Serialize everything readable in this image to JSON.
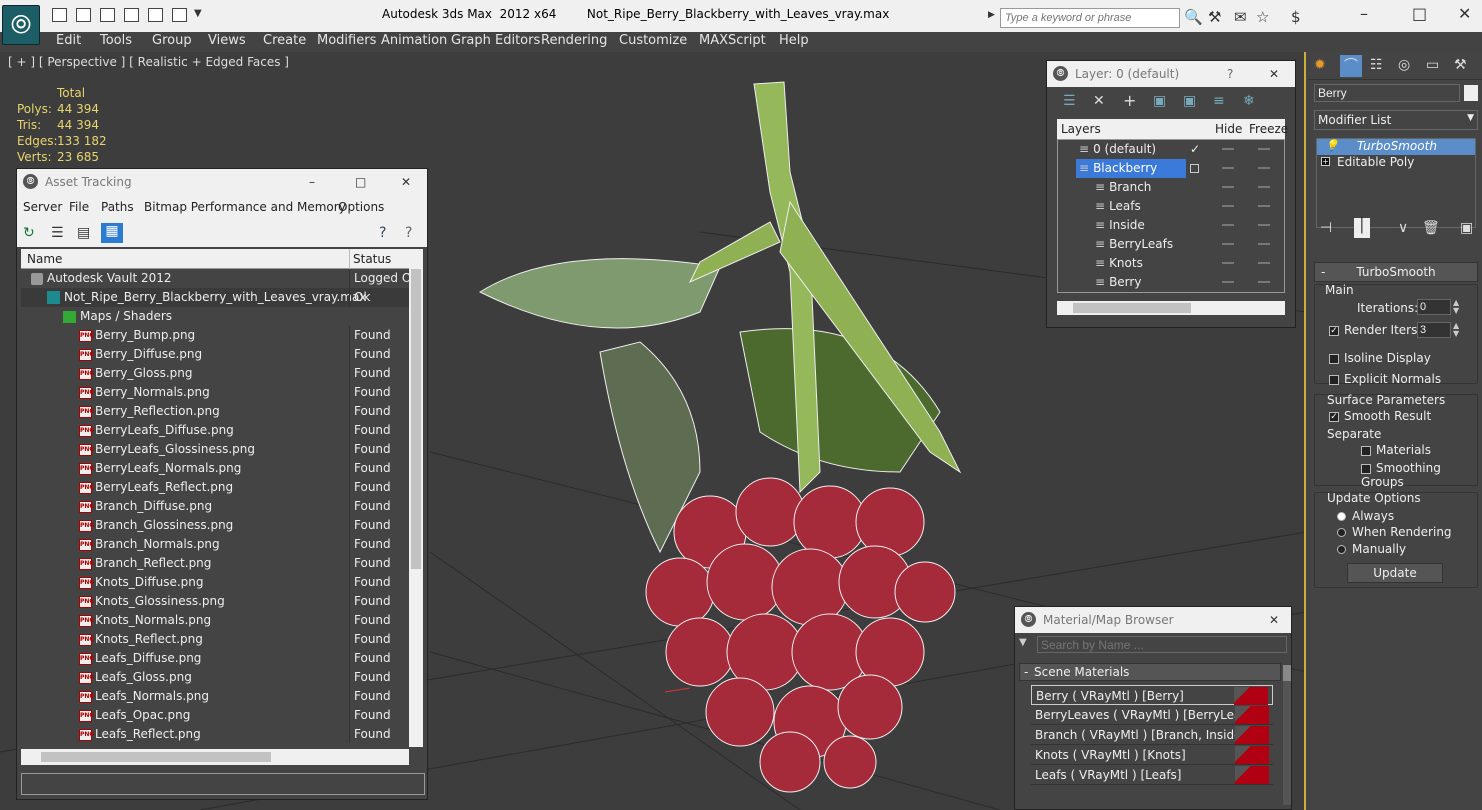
{
  "titlebar": {
    "title": "Autodesk 3ds Max  2012 x64        Not_Ripe_Berry_Blackberry_with_Leaves_vray.max",
    "search_placeholder": "Type a keyword or phrase"
  },
  "menu": [
    "Edit",
    "Tools",
    "Group",
    "Views",
    "Create",
    "Modifiers",
    "Animation",
    "Graph Editors",
    "Rendering",
    "Customize",
    "MAXScript",
    "Help"
  ],
  "viewport": {
    "label": "[ + ] [ Perspective ] [ Realistic + Edged Faces ]",
    "stats_header": "Total",
    "stats": [
      {
        "label": "Polys:",
        "value": "44 394"
      },
      {
        "label": "Tris:",
        "value": "44 394"
      },
      {
        "label": "Edges:",
        "value": "133 182"
      },
      {
        "label": "Verts:",
        "value": "23 685"
      }
    ]
  },
  "asset_tracking": {
    "title": "Asset Tracking",
    "menu": [
      "Server",
      "File",
      "Paths",
      "Bitmap Performance and Memory",
      "Options"
    ],
    "col_name": "Name",
    "col_status": "Status",
    "rows": [
      {
        "name": "Autodesk Vault 2012",
        "status": "Logged Ou",
        "indent": 1,
        "icon": "vault"
      },
      {
        "name": "Not_Ripe_Berry_Blackberry_with_Leaves_vray.max",
        "status": "Ok",
        "indent": 2,
        "icon": "max"
      },
      {
        "name": "Maps / Shaders",
        "status": "",
        "indent": 3,
        "icon": "maps"
      },
      {
        "name": "Berry_Bump.png",
        "status": "Found",
        "indent": 4,
        "icon": "png"
      },
      {
        "name": "Berry_Diffuse.png",
        "status": "Found",
        "indent": 4,
        "icon": "png"
      },
      {
        "name": "Berry_Gloss.png",
        "status": "Found",
        "indent": 4,
        "icon": "png"
      },
      {
        "name": "Berry_Normals.png",
        "status": "Found",
        "indent": 4,
        "icon": "png"
      },
      {
        "name": "Berry_Reflection.png",
        "status": "Found",
        "indent": 4,
        "icon": "png"
      },
      {
        "name": "BerryLeafs_Diffuse.png",
        "status": "Found",
        "indent": 4,
        "icon": "png"
      },
      {
        "name": "BerryLeafs_Glossiness.png",
        "status": "Found",
        "indent": 4,
        "icon": "png"
      },
      {
        "name": "BerryLeafs_Normals.png",
        "status": "Found",
        "indent": 4,
        "icon": "png"
      },
      {
        "name": "BerryLeafs_Reflect.png",
        "status": "Found",
        "indent": 4,
        "icon": "png"
      },
      {
        "name": "Branch_Diffuse.png",
        "status": "Found",
        "indent": 4,
        "icon": "png"
      },
      {
        "name": "Branch_Glossiness.png",
        "status": "Found",
        "indent": 4,
        "icon": "png"
      },
      {
        "name": "Branch_Normals.png",
        "status": "Found",
        "indent": 4,
        "icon": "png"
      },
      {
        "name": "Branch_Reflect.png",
        "status": "Found",
        "indent": 4,
        "icon": "png"
      },
      {
        "name": "Knots_Diffuse.png",
        "status": "Found",
        "indent": 4,
        "icon": "png"
      },
      {
        "name": "Knots_Glossiness.png",
        "status": "Found",
        "indent": 4,
        "icon": "png"
      },
      {
        "name": "Knots_Normals.png",
        "status": "Found",
        "indent": 4,
        "icon": "png"
      },
      {
        "name": "Knots_Reflect.png",
        "status": "Found",
        "indent": 4,
        "icon": "png"
      },
      {
        "name": "Leafs_Diffuse.png",
        "status": "Found",
        "indent": 4,
        "icon": "png"
      },
      {
        "name": "Leafs_Gloss.png",
        "status": "Found",
        "indent": 4,
        "icon": "png"
      },
      {
        "name": "Leafs_Normals.png",
        "status": "Found",
        "indent": 4,
        "icon": "png"
      },
      {
        "name": "Leafs_Opac.png",
        "status": "Found",
        "indent": 4,
        "icon": "png"
      },
      {
        "name": "Leafs_Reflect.png",
        "status": "Found",
        "indent": 4,
        "icon": "png"
      }
    ]
  },
  "layer_panel": {
    "title": "Layer: 0 (default)",
    "help": "?",
    "col_layers": "Layers",
    "col_hide": "Hide",
    "col_freeze": "Freeze",
    "rows": [
      {
        "name": "0 (default)",
        "level": 1,
        "selected": false,
        "active": true
      },
      {
        "name": "Blackberry",
        "level": 1,
        "selected": true,
        "active": false
      },
      {
        "name": "Branch",
        "level": 2,
        "selected": false,
        "active": false
      },
      {
        "name": "Leafs",
        "level": 2,
        "selected": false,
        "active": false
      },
      {
        "name": "Inside",
        "level": 2,
        "selected": false,
        "active": false
      },
      {
        "name": "BerryLeafs",
        "level": 2,
        "selected": false,
        "active": false
      },
      {
        "name": "Knots",
        "level": 2,
        "selected": false,
        "active": false
      },
      {
        "name": "Berry",
        "level": 2,
        "selected": false,
        "active": false
      }
    ]
  },
  "command_panel": {
    "object_name": "Berry",
    "modifier_list": "Modifier List",
    "stack": [
      {
        "name": "TurboSmooth",
        "selected": true
      },
      {
        "name": "Editable Poly",
        "selected": false
      }
    ],
    "rollout_title": "TurboSmooth",
    "main_label": "Main",
    "iterations_label": "Iterations:",
    "iterations_value": "0",
    "render_iters_label": "Render Iters:",
    "render_iters_value": "3",
    "isoline_label": "Isoline Display",
    "explicit_normals_label": "Explicit Normals",
    "surface_label": "Surface Parameters",
    "smooth_result_label": "Smooth Result",
    "separate_label": "Separate",
    "materials_label": "Materials",
    "smoothing_groups_label": "Smoothing Groups",
    "update_options_label": "Update Options",
    "always_label": "Always",
    "when_rendering_label": "When Rendering",
    "manually_label": "Manually",
    "update_button": "Update"
  },
  "material_browser": {
    "title": "Material/Map Browser",
    "search_placeholder": "Search by Name ...",
    "section": "Scene Materials",
    "items": [
      "Berry  ( VRayMtl ) [Berry]",
      "BerryLeaves  ( VRayMtl ) [BerryLeafs]",
      "Branch  ( VRayMtl ) [Branch, Inside]",
      "Knots  ( VRayMtl ) [Knots]",
      "Leafs  ( VRayMtl ) [Leafs]"
    ]
  }
}
